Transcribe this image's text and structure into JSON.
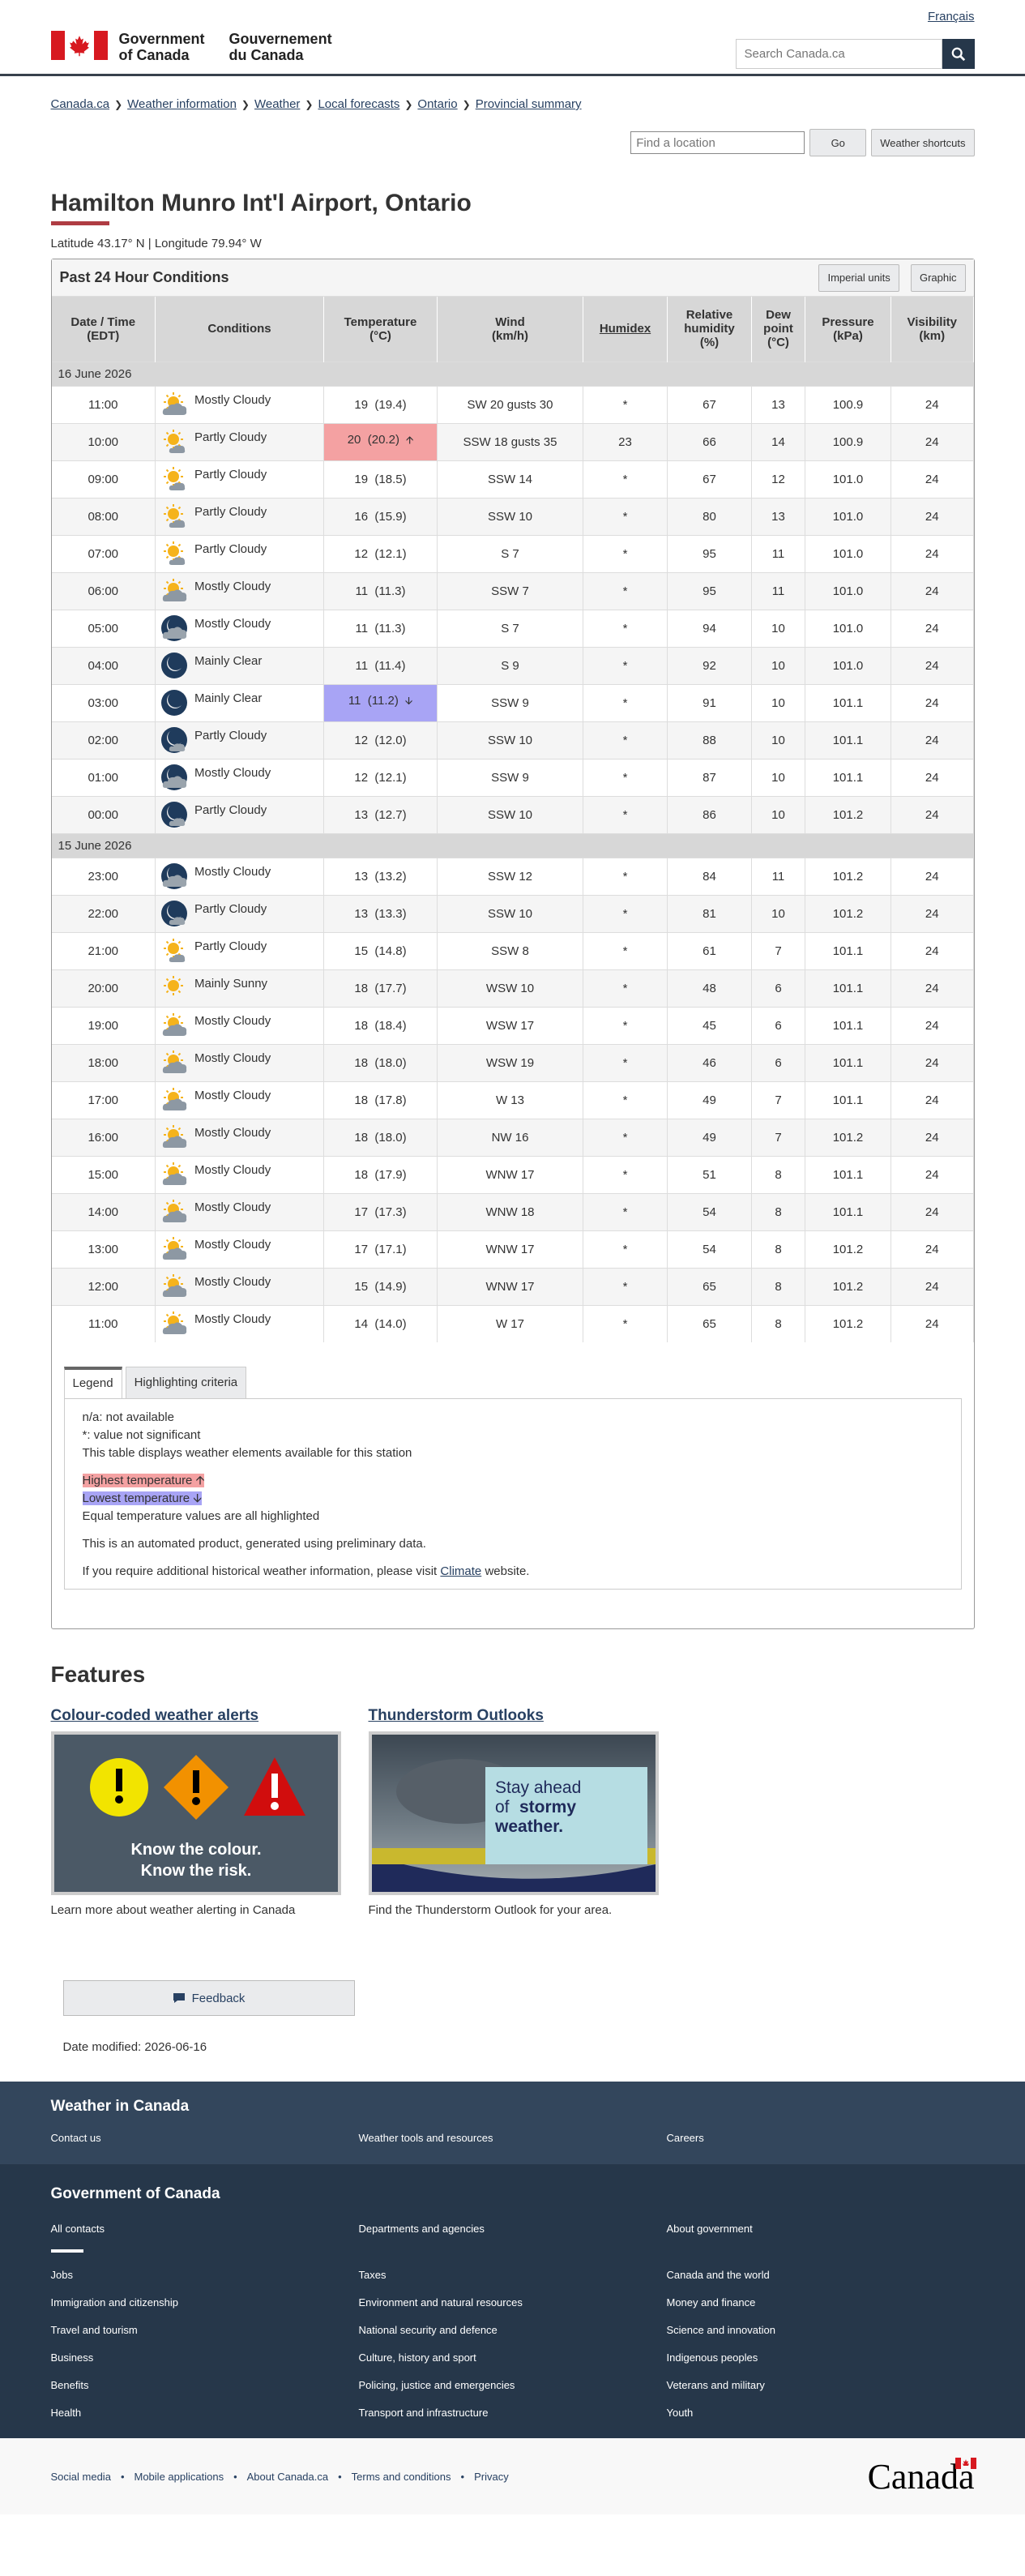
{
  "header": {
    "lang": "Français",
    "sig_en_1": "Government",
    "sig_en_2": "of Canada",
    "sig_fr_1": "Gouvernement",
    "sig_fr_2": "du Canada",
    "search_placeholder": "Search Canada.ca"
  },
  "breadcrumb": [
    "Canada.ca",
    "Weather information",
    "Weather",
    "Local forecasts",
    "Ontario",
    "Provincial summary"
  ],
  "location_tools": {
    "placeholder": "Find a location",
    "go": "Go",
    "shortcuts": "Weather shortcuts"
  },
  "page": {
    "title": "Hamilton Munro Int'l Airport, Ontario",
    "latlon": "Latitude 43.17° N | Longitude 79.94° W"
  },
  "panel": {
    "title": "Past 24 Hour Conditions",
    "imperial": "Imperial units",
    "graphic": "Graphic"
  },
  "columns": {
    "datetime": [
      "Date / Time",
      "(EDT)"
    ],
    "conditions": "Conditions",
    "temperature": [
      "Temperature",
      "(°C)"
    ],
    "wind": [
      "Wind",
      "(km/h)"
    ],
    "humidex": "Humidex",
    "humidity": [
      "Relative",
      "humidity",
      "(%)"
    ],
    "dew": [
      "Dew",
      "point",
      "(°C)"
    ],
    "pressure": [
      "Pressure",
      "(kPa)"
    ],
    "visibility": [
      "Visibility",
      "(km)"
    ]
  },
  "days": [
    {
      "date": "16 June 2026",
      "rows": [
        {
          "time": "11:00",
          "icon": "mostly-cloudy-day",
          "cond": "Mostly Cloudy",
          "temp": "19",
          "temp2": "(19.4)",
          "wind": "SW 20 gusts 30",
          "humidex": "*",
          "rh": "67",
          "dew": "13",
          "press": "100.9",
          "vis": "24"
        },
        {
          "time": "10:00",
          "icon": "partly-cloudy-day",
          "cond": "Partly Cloudy",
          "temp": "20",
          "temp2": "(20.2)",
          "hl": "high",
          "wind": "SSW 18 gusts 35",
          "humidex": "23",
          "rh": "66",
          "dew": "14",
          "press": "100.9",
          "vis": "24"
        },
        {
          "time": "09:00",
          "icon": "partly-cloudy-day",
          "cond": "Partly Cloudy",
          "temp": "19",
          "temp2": "(18.5)",
          "wind": "SSW 14",
          "humidex": "*",
          "rh": "67",
          "dew": "12",
          "press": "101.0",
          "vis": "24"
        },
        {
          "time": "08:00",
          "icon": "partly-cloudy-day",
          "cond": "Partly Cloudy",
          "temp": "16",
          "temp2": "(15.9)",
          "wind": "SSW 10",
          "humidex": "*",
          "rh": "80",
          "dew": "13",
          "press": "101.0",
          "vis": "24"
        },
        {
          "time": "07:00",
          "icon": "partly-cloudy-day",
          "cond": "Partly Cloudy",
          "temp": "12",
          "temp2": "(12.1)",
          "wind": "S 7",
          "humidex": "*",
          "rh": "95",
          "dew": "11",
          "press": "101.0",
          "vis": "24"
        },
        {
          "time": "06:00",
          "icon": "mostly-cloudy-day",
          "cond": "Mostly Cloudy",
          "temp": "11",
          "temp2": "(11.3)",
          "wind": "SSW 7",
          "humidex": "*",
          "rh": "95",
          "dew": "11",
          "press": "101.0",
          "vis": "24"
        },
        {
          "time": "05:00",
          "icon": "mostly-cloudy-night",
          "cond": "Mostly Cloudy",
          "temp": "11",
          "temp2": "(11.3)",
          "wind": "S 7",
          "humidex": "*",
          "rh": "94",
          "dew": "10",
          "press": "101.0",
          "vis": "24"
        },
        {
          "time": "04:00",
          "icon": "mainly-clear-night",
          "cond": "Mainly Clear",
          "temp": "11",
          "temp2": "(11.4)",
          "wind": "S 9",
          "humidex": "*",
          "rh": "92",
          "dew": "10",
          "press": "101.0",
          "vis": "24"
        },
        {
          "time": "03:00",
          "icon": "mainly-clear-night",
          "cond": "Mainly Clear",
          "temp": "11",
          "temp2": "(11.2)",
          "hl": "low",
          "wind": "SSW 9",
          "humidex": "*",
          "rh": "91",
          "dew": "10",
          "press": "101.1",
          "vis": "24"
        },
        {
          "time": "02:00",
          "icon": "partly-cloudy-night",
          "cond": "Partly Cloudy",
          "temp": "12",
          "temp2": "(12.0)",
          "wind": "SSW 10",
          "humidex": "*",
          "rh": "88",
          "dew": "10",
          "press": "101.1",
          "vis": "24"
        },
        {
          "time": "01:00",
          "icon": "mostly-cloudy-night",
          "cond": "Mostly Cloudy",
          "temp": "12",
          "temp2": "(12.1)",
          "wind": "SSW 9",
          "humidex": "*",
          "rh": "87",
          "dew": "10",
          "press": "101.1",
          "vis": "24"
        },
        {
          "time": "00:00",
          "icon": "partly-cloudy-night",
          "cond": "Partly Cloudy",
          "temp": "13",
          "temp2": "(12.7)",
          "wind": "SSW 10",
          "humidex": "*",
          "rh": "86",
          "dew": "10",
          "press": "101.2",
          "vis": "24"
        }
      ]
    },
    {
      "date": "15 June 2026",
      "rows": [
        {
          "time": "23:00",
          "icon": "mostly-cloudy-night",
          "cond": "Mostly Cloudy",
          "temp": "13",
          "temp2": "(13.2)",
          "wind": "SSW 12",
          "humidex": "*",
          "rh": "84",
          "dew": "11",
          "press": "101.2",
          "vis": "24"
        },
        {
          "time": "22:00",
          "icon": "partly-cloudy-night",
          "cond": "Partly Cloudy",
          "temp": "13",
          "temp2": "(13.3)",
          "wind": "SSW 10",
          "humidex": "*",
          "rh": "81",
          "dew": "10",
          "press": "101.2",
          "vis": "24"
        },
        {
          "time": "21:00",
          "icon": "partly-cloudy-day",
          "cond": "Partly Cloudy",
          "temp": "15",
          "temp2": "(14.8)",
          "wind": "SSW 8",
          "humidex": "*",
          "rh": "61",
          "dew": "7",
          "press": "101.1",
          "vis": "24"
        },
        {
          "time": "20:00",
          "icon": "sunny",
          "cond": "Mainly Sunny",
          "temp": "18",
          "temp2": "(17.7)",
          "wind": "WSW 10",
          "humidex": "*",
          "rh": "48",
          "dew": "6",
          "press": "101.1",
          "vis": "24"
        },
        {
          "time": "19:00",
          "icon": "mostly-cloudy-day",
          "cond": "Mostly Cloudy",
          "temp": "18",
          "temp2": "(18.4)",
          "wind": "WSW 17",
          "humidex": "*",
          "rh": "45",
          "dew": "6",
          "press": "101.1",
          "vis": "24"
        },
        {
          "time": "18:00",
          "icon": "mostly-cloudy-day",
          "cond": "Mostly Cloudy",
          "temp": "18",
          "temp2": "(18.0)",
          "wind": "WSW 19",
          "humidex": "*",
          "rh": "46",
          "dew": "6",
          "press": "101.1",
          "vis": "24"
        },
        {
          "time": "17:00",
          "icon": "mostly-cloudy-day",
          "cond": "Mostly Cloudy",
          "temp": "18",
          "temp2": "(17.8)",
          "wind": "W 13",
          "humidex": "*",
          "rh": "49",
          "dew": "7",
          "press": "101.1",
          "vis": "24"
        },
        {
          "time": "16:00",
          "icon": "mostly-cloudy-day",
          "cond": "Mostly Cloudy",
          "temp": "18",
          "temp2": "(18.0)",
          "wind": "NW 16",
          "humidex": "*",
          "rh": "49",
          "dew": "7",
          "press": "101.2",
          "vis": "24"
        },
        {
          "time": "15:00",
          "icon": "mostly-cloudy-day",
          "cond": "Mostly Cloudy",
          "temp": "18",
          "temp2": "(17.9)",
          "wind": "WNW 17",
          "humidex": "*",
          "rh": "51",
          "dew": "8",
          "press": "101.1",
          "vis": "24"
        },
        {
          "time": "14:00",
          "icon": "mostly-cloudy-day",
          "cond": "Mostly Cloudy",
          "temp": "17",
          "temp2": "(17.3)",
          "wind": "WNW 18",
          "humidex": "*",
          "rh": "54",
          "dew": "8",
          "press": "101.1",
          "vis": "24"
        },
        {
          "time": "13:00",
          "icon": "mostly-cloudy-day",
          "cond": "Mostly Cloudy",
          "temp": "17",
          "temp2": "(17.1)",
          "wind": "WNW 17",
          "humidex": "*",
          "rh": "54",
          "dew": "8",
          "press": "101.2",
          "vis": "24"
        },
        {
          "time": "12:00",
          "icon": "mostly-cloudy-day",
          "cond": "Mostly Cloudy",
          "temp": "15",
          "temp2": "(14.9)",
          "wind": "WNW 17",
          "humidex": "*",
          "rh": "65",
          "dew": "8",
          "press": "101.2",
          "vis": "24"
        },
        {
          "time": "11:00",
          "icon": "mostly-cloudy-day",
          "cond": "Mostly Cloudy",
          "temp": "14",
          "temp2": "(14.0)",
          "wind": "W 17",
          "humidex": "*",
          "rh": "65",
          "dew": "8",
          "press": "101.2",
          "vis": "24"
        }
      ]
    }
  ],
  "legend": {
    "tab_legend": "Legend",
    "tab_criteria": "Highlighting criteria",
    "na": "n/a: not available",
    "star": "*: value not significant",
    "desc": "This table displays weather elements available for this station",
    "high": "Highest temperature",
    "low": "Lowest temperature",
    "equal": "Equal temperature values are all highlighted",
    "auto": "This is an automated product, generated using preliminary data.",
    "hist_pre": "If you require additional historical weather information, please visit",
    "hist_link": "Climate",
    "hist_post": "website."
  },
  "features": {
    "heading": "Features",
    "items": [
      {
        "title": "Colour-coded weather alerts",
        "img_line1": "Know the colour.",
        "img_line2": "Know the risk.",
        "desc": "Learn more about weather alerting in Canada"
      },
      {
        "title": "Thunderstorm Outlooks",
        "img_line1": "Stay ahead",
        "img_line2": "of",
        "img_line3": "stormy",
        "img_line4": "weather.",
        "desc": "Find the Thunderstorm Outlook for your area."
      }
    ]
  },
  "feedback": "Feedback",
  "modified": "Date modified: 2026-06-16",
  "footer": {
    "weather_heading": "Weather in Canada",
    "weather_links": [
      "Contact us",
      "Weather tools and resources",
      "Careers"
    ],
    "gov_heading": "Government of Canada",
    "gov_top": [
      "All contacts",
      "Departments and agencies",
      "About government"
    ],
    "gov_links": [
      "Jobs",
      "Taxes",
      "Canada and the world",
      "Immigration and citizenship",
      "Environment and natural resources",
      "Money and finance",
      "Travel and tourism",
      "National security and defence",
      "Science and innovation",
      "Business",
      "Culture, history and sport",
      "Indigenous peoples",
      "Benefits",
      "Policing, justice and emergencies",
      "Veterans and military",
      "Health",
      "Transport and infrastructure",
      "Youth"
    ],
    "bottom_links": [
      "Social media",
      "Mobile applications",
      "About Canada.ca",
      "Terms and conditions",
      "Privacy"
    ],
    "wordmark": "Canada"
  },
  "colors": {
    "high": "#f4a1a2",
    "low": "#a8a4f5",
    "header_rule": "#38414d",
    "footer_top": "#33465c",
    "footer_mid": "#26374a"
  }
}
